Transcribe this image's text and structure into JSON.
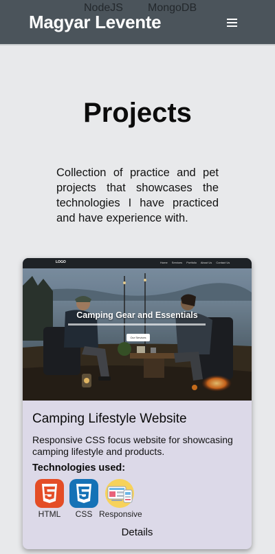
{
  "header": {
    "brand": "Magyar Levente",
    "ghost_items": [
      "NodeJS",
      "MongoDB"
    ],
    "menu_icon": "hamburger-icon"
  },
  "main": {
    "title": "Projects",
    "intro": "Collection of practice and pet projects that showcases the technologies I have practiced and have experience with."
  },
  "project": {
    "screenshot": {
      "logo": "LOGO",
      "nav_links": [
        "Home",
        "Services",
        "Portfolio",
        "About Us",
        "Contact Us"
      ],
      "hero_title": "Camping Gear and Essentials",
      "hero_button": "Our Services"
    },
    "title": "Camping Lifestyle Website",
    "description": "Responsive CSS focus website for showcasing camping lifestyle and products.",
    "tech_heading": "Technologies used:",
    "technologies": [
      {
        "label": "HTML",
        "icon": "html5-icon"
      },
      {
        "label": "CSS",
        "icon": "css3-icon"
      },
      {
        "label": "Responsive",
        "icon": "responsive-devices-icon"
      }
    ],
    "details_label": "Details"
  },
  "colors": {
    "header_bg": "#4b545b",
    "page_bg": "#e8e9eb",
    "card_bg": "#dcd9e8",
    "html_orange": "#e44d26",
    "css_blue": "#1572b6",
    "responsive_yellow": "#f7d25a"
  }
}
